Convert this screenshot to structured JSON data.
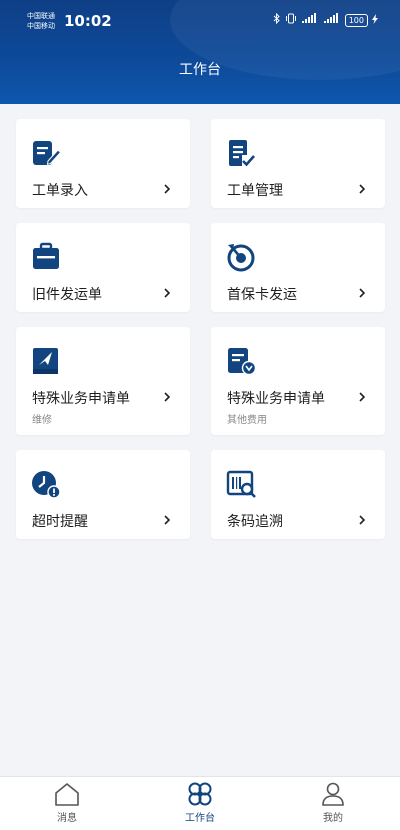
{
  "status_bar": {
    "carrier_1": "中国联通",
    "carrier_2": "中国移动",
    "time": "10:02",
    "battery": "100"
  },
  "header": {
    "title": "工作台"
  },
  "cards": [
    {
      "label": "工单录入",
      "sublabel": "",
      "icon": "edit-document-icon"
    },
    {
      "label": "工单管理",
      "sublabel": "",
      "icon": "document-check-icon"
    },
    {
      "label": "旧件发运单",
      "sublabel": "",
      "icon": "clipboard-icon"
    },
    {
      "label": "首保卡发运",
      "sublabel": "",
      "icon": "target-icon"
    },
    {
      "label": "特殊业务申请单",
      "sublabel": "维修",
      "icon": "book-flag-icon"
    },
    {
      "label": "特殊业务申请单",
      "sublabel": "其他费用",
      "icon": "document-badge-icon"
    },
    {
      "label": "超时提醒",
      "sublabel": "",
      "icon": "clock-alert-icon"
    },
    {
      "label": "条码追溯",
      "sublabel": "",
      "icon": "barcode-search-icon"
    }
  ],
  "tabbar": {
    "tabs": [
      {
        "label": "消息",
        "icon": "home-icon",
        "active": false
      },
      {
        "label": "工作台",
        "icon": "clover-icon",
        "active": true
      },
      {
        "label": "我的",
        "icon": "user-icon",
        "active": false
      }
    ]
  },
  "colors": {
    "primary": "#12447f",
    "background": "#f2f4f7"
  }
}
